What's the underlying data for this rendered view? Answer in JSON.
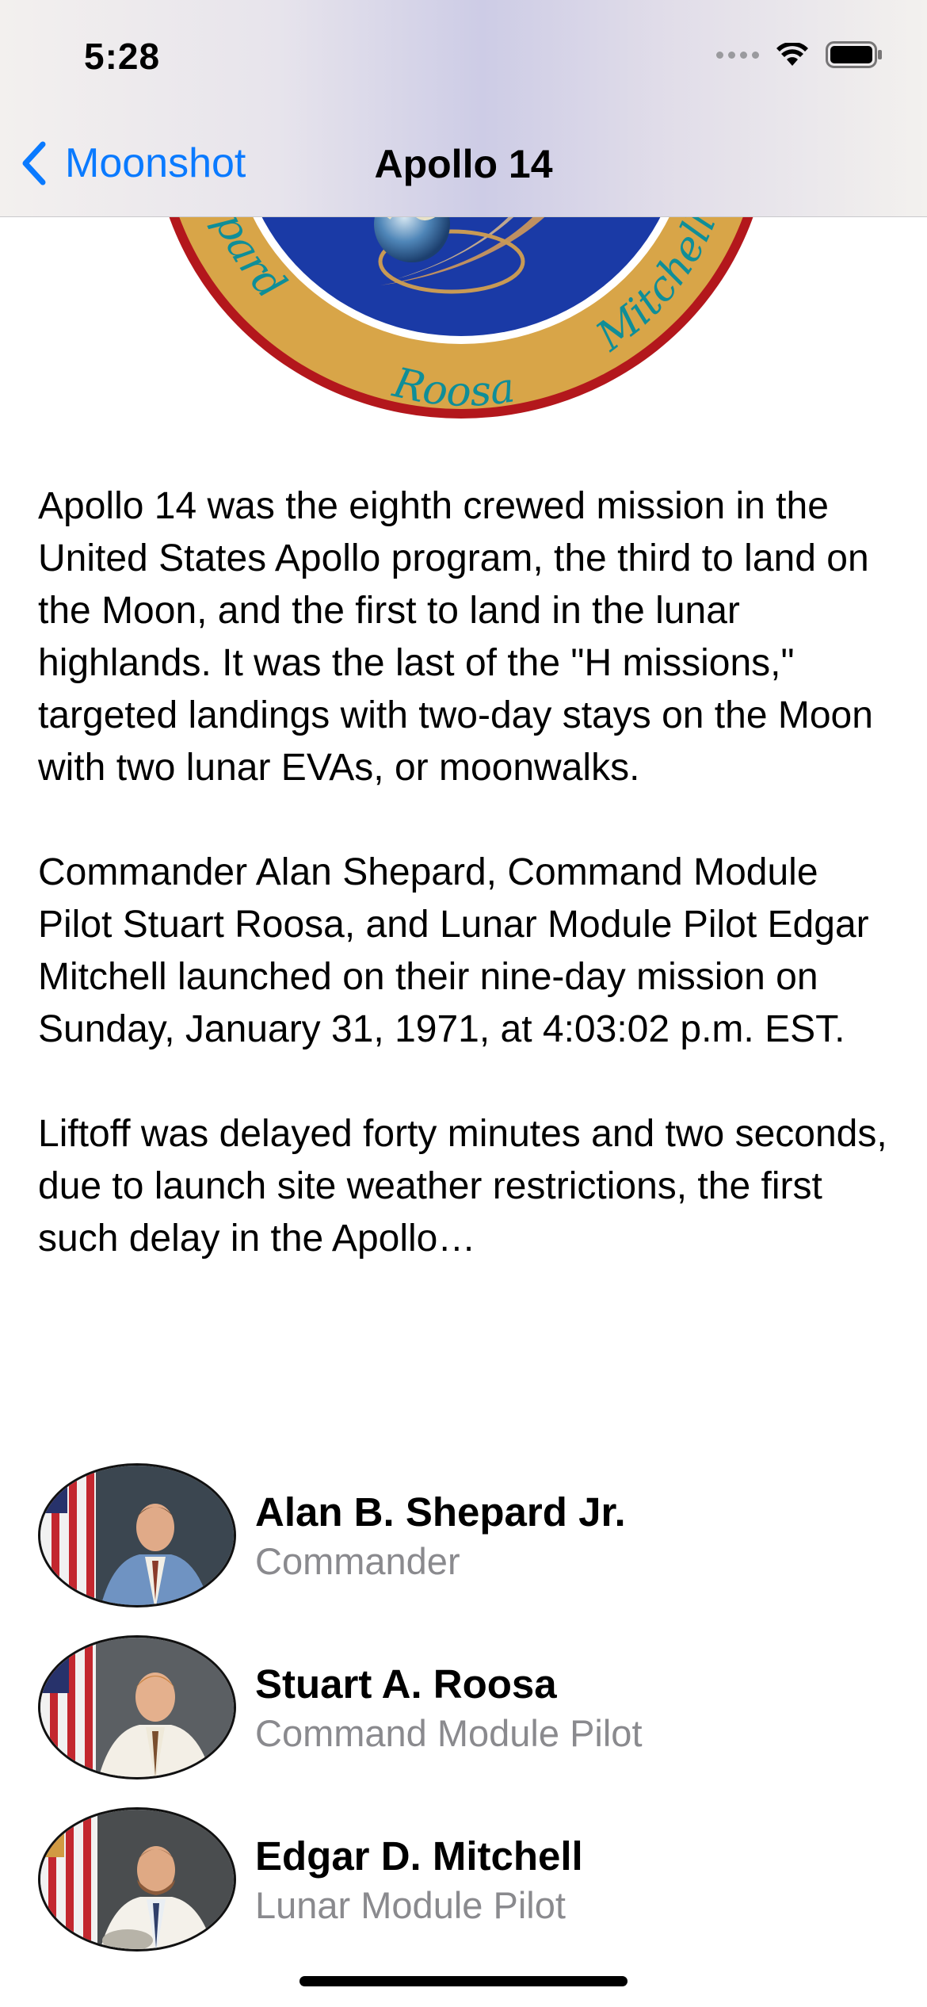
{
  "status_bar": {
    "time": "5:28",
    "icons": [
      "cellular-signal-icon",
      "wifi-icon",
      "battery-icon"
    ]
  },
  "nav": {
    "back_label": "Moonshot",
    "title": "Apollo 14"
  },
  "badge": {
    "names": {
      "left": "Shepard",
      "bottom": "Roosa",
      "right": "Mitchell"
    },
    "colors": {
      "outer_ring": "#b3171c",
      "gold": "#d8a548",
      "inner": "#1a3aa6"
    }
  },
  "description": {
    "paragraphs": [
      "Apollo 14 was the eighth crewed mission in the United States Apollo program, the third to land on the Moon, and the first to land in the lunar highlands. It was the last of the \"H missions,\" targeted landings with two-day stays on the Moon with two lunar EVAs, or moonwalks.",
      "Commander Alan Shepard, Command Module Pilot Stuart Roosa, and Lunar Module Pilot Edgar Mitchell launched on their nine-day mission on Sunday, January 31, 1971, at 4:03:02 p.m. EST.",
      "Liftoff was delayed forty minutes and two seconds, due to launch site weather restrictions, the first such delay in the Apollo…"
    ]
  },
  "crew": [
    {
      "name": "Alan B. Shepard Jr.",
      "role": "Commander"
    },
    {
      "name": "Stuart A. Roosa",
      "role": "Command Module Pilot"
    },
    {
      "name": "Edgar D. Mitchell",
      "role": "Lunar Module Pilot"
    }
  ],
  "colors": {
    "accent": "#0a7aff",
    "secondary_text": "#8a8a8e"
  }
}
